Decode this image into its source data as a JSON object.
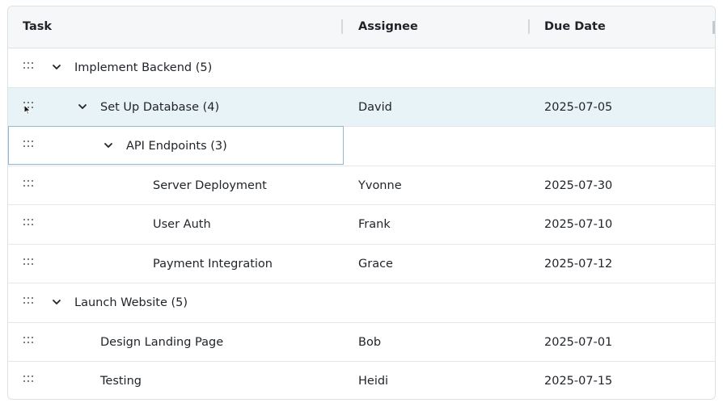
{
  "columns": {
    "task": "Task",
    "assignee": "Assignee",
    "due_date": "Due Date"
  },
  "rows": [
    {
      "task": "Implement Backend (5)",
      "assignee": "",
      "due": "",
      "level": 0,
      "group": true
    },
    {
      "task": "Set Up Database (4)",
      "assignee": "David",
      "due": "2025-07-05",
      "level": 1,
      "group": true
    },
    {
      "task": "API Endpoints (3)",
      "assignee": "",
      "due": "",
      "level": 2,
      "group": true
    },
    {
      "task": "Server Deployment",
      "assignee": "Yvonne",
      "due": "2025-07-30",
      "level": 3,
      "group": false
    },
    {
      "task": "User Auth",
      "assignee": "Frank",
      "due": "2025-07-10",
      "level": 3,
      "group": false
    },
    {
      "task": "Payment Integration",
      "assignee": "Grace",
      "due": "2025-07-12",
      "level": 3,
      "group": false
    },
    {
      "task": "Launch Website (5)",
      "assignee": "",
      "due": "",
      "level": 0,
      "group": true
    },
    {
      "task": "Design Landing Page",
      "assignee": "Bob",
      "due": "2025-07-01",
      "level": 1,
      "group": false
    },
    {
      "task": "Testing",
      "assignee": "Heidi",
      "due": "2025-07-15",
      "level": 1,
      "group": false
    }
  ],
  "icons": {
    "drag": "drag-handle-icon",
    "expand": "chevron-down-icon",
    "cursor": "mouse-pointer-icon"
  },
  "colors": {
    "header_bg": "#f6f7f9",
    "selected_row_bg": "#e8f3f7",
    "focus_border": "#8fb8d6",
    "border": "#dde2e7"
  }
}
